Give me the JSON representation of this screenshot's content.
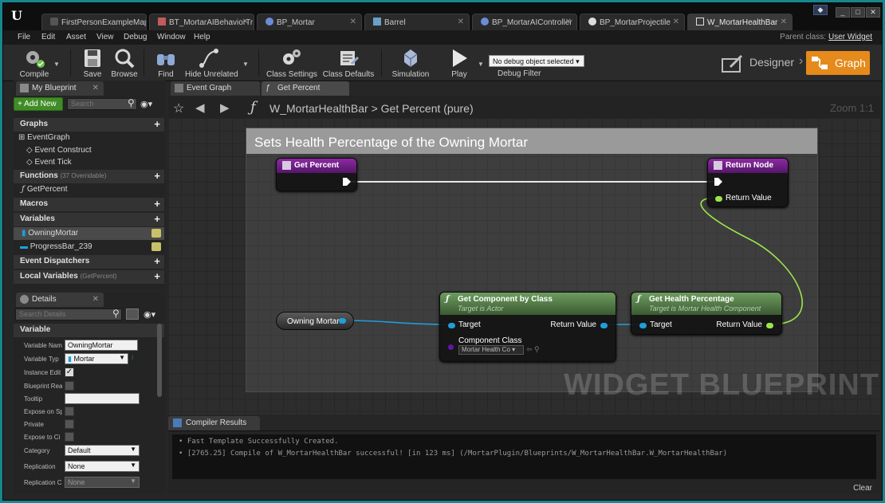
{
  "app": {
    "tabs": [
      {
        "label": "FirstPersonExampleMap*",
        "color": "#7a7a7a"
      },
      {
        "label": "BT_MortarAIBehaviorTr",
        "color": "#c25b5b"
      },
      {
        "label": "BP_Mortar",
        "color": "#6c8cd5"
      },
      {
        "label": "Barrel",
        "color": "#6aa0c9"
      },
      {
        "label": "BP_MortarAIController",
        "color": "#6c8cd5"
      },
      {
        "label": "BP_MortarProjectile",
        "color": "#dddddd"
      },
      {
        "label": "W_MortarHealthBar",
        "color": "#dddddd"
      }
    ],
    "menu": [
      "File",
      "Edit",
      "Asset",
      "View",
      "Debug",
      "Window",
      "Help"
    ],
    "parent_class_label": "Parent class:",
    "parent_class_value": "User Widget",
    "window_controls": [
      "_",
      "□",
      "✕"
    ]
  },
  "toolbar": {
    "compile": "Compile",
    "save": "Save",
    "browse": "Browse",
    "find": "Find",
    "hide_unrelated": "Hide Unrelated",
    "class_settings": "Class Settings",
    "class_defaults": "Class Defaults",
    "simulation": "Simulation",
    "play": "Play",
    "debug_object": "No debug object selected",
    "debug_filter": "Debug Filter",
    "designer": "Designer",
    "graph": "Graph"
  },
  "my_blueprint": {
    "tab": "My Blueprint",
    "add_new": "+ Add New",
    "search_placeholder": "Search",
    "graphs_header": "Graphs",
    "event_graph": "EventGraph",
    "event_construct": "Event Construct",
    "event_tick": "Event Tick",
    "functions_header": "Functions",
    "functions_sub": "(37 Overridable)",
    "get_percent": "GetPercent",
    "macros_header": "Macros",
    "variables_header": "Variables",
    "var_owning_mortar": "OwningMortar",
    "var_progress_bar": "ProgressBar_239",
    "event_dispatchers_header": "Event Dispatchers",
    "local_variables_header": "Local Variables",
    "local_variables_sub": "(GetPercent)"
  },
  "details": {
    "tab": "Details",
    "search_placeholder": "Search Details",
    "section": "Variable",
    "rows": {
      "variable_name_label": "Variable Nam",
      "variable_name_value": "OwningMortar",
      "variable_type_label": "Variable Typ",
      "variable_type_value": "Mortar",
      "instance_editable_label": "Instance Edit",
      "blueprint_read_label": "Blueprint Rea",
      "tooltip_label": "Tooltip",
      "expose_on_spawn_label": "Expose on Sp",
      "private_label": "Private",
      "expose_to_cinematics_label": "Expose to Ci",
      "category_label": "Category",
      "category_value": "Default",
      "replication_label": "Replication",
      "replication_value": "None",
      "replication_condition_label": "Replication C",
      "replication_condition_value": "None"
    }
  },
  "graph_tabs": {
    "event_graph": "Event Graph",
    "get_percent": "Get Percent"
  },
  "breadcrumb": {
    "blueprint": "W_MortarHealthBar",
    "separator": ">",
    "function": "Get Percent (pure)",
    "zoom": "Zoom 1:1"
  },
  "graph": {
    "comment": "Sets Health Percentage of the Owning Mortar",
    "node_get_percent": "Get Percent",
    "node_return": "Return Node",
    "return_value": "Return Value",
    "node_get_component": "Get Component by Class",
    "node_get_component_sub": "Target is Actor",
    "target": "Target",
    "component_class": "Component Class",
    "component_class_value": "Mortar Health Co",
    "node_get_health": "Get Health Percentage",
    "node_get_health_sub": "Target is Mortar Health Component",
    "var_node": "Owning Mortar",
    "watermark": "WIDGET BLUEPRINT"
  },
  "compiler_results": {
    "tab": "Compiler Results",
    "lines": [
      "• Fast Template Successfully Created.",
      "• [2765.25] Compile of W_MortarHealthBar successful! [in 123 ms] (/MortarPlugin/Blueprints/W_MortarHealthBar.W_MortarHealthBar)"
    ],
    "clear": "Clear"
  },
  "colors": {
    "accent": "#e58a1b",
    "pin_object": "#1e9fd9",
    "pin_float": "#9be64a",
    "pin_class": "#5e1a9e"
  }
}
